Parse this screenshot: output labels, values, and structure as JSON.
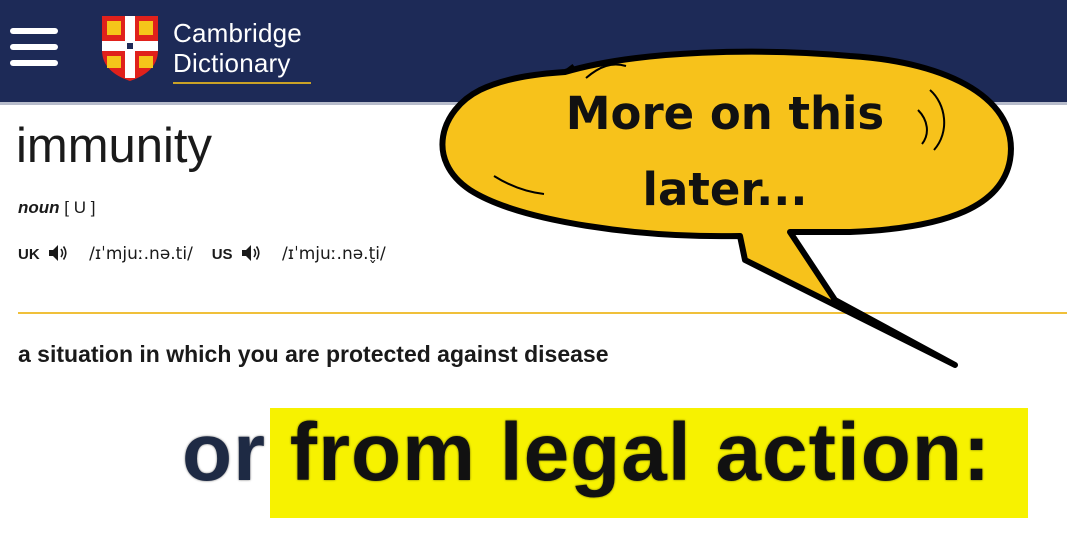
{
  "header": {
    "menu_icon": "hamburger-menu-icon",
    "logo_line1": "Cambridge",
    "logo_line2": "Dictionary",
    "logo_icon": "cambridge-shield-icon",
    "background": "#1d2a57",
    "logo_underline_color": "#c9a227"
  },
  "entry": {
    "headword": "immunity",
    "pos": "noun",
    "grammar": "[ U ]",
    "pronunciations": [
      {
        "region": "UK",
        "audio_icon": "speaker-icon",
        "ipa": "/ɪˈmjuː.nə.ti/"
      },
      {
        "region": "US",
        "audio_icon": "speaker-icon",
        "ipa": "/ɪˈmjuː.nə.t̬i/"
      }
    ],
    "definition": "a situation in which you are protected against disease",
    "divider_color": "#f0c03a"
  },
  "zoom": {
    "prefix": "or",
    "highlighted": "from legal action:",
    "highlight_color": "#f7f200"
  },
  "callout": {
    "line1": "More on this",
    "line2": "later...",
    "fill": "#f7c21b"
  }
}
